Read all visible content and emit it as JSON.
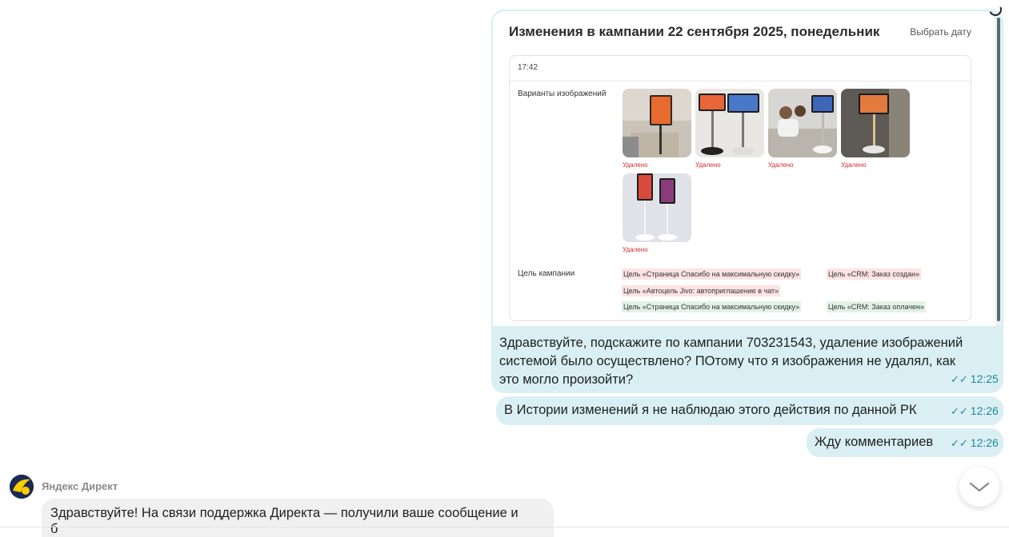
{
  "screenshot": {
    "title": "Изменения в кампании 22 сентября 2025, понедельник",
    "choose_date": "Выбрать дату",
    "time": "17:42",
    "images_label": "Варианты изображений",
    "image_status": "Удалено",
    "goal_label": "Цель кампании",
    "goals_removed": [
      "Цель «Страница Спасибо на максимальную скидку»",
      "Цель «CRM: Заказ создан»",
      "Цель «Автоцель Jivo: автоприглашение в чат»"
    ],
    "goals_added": [
      "Цель «Страница Спасибо на максимальную скидку»",
      "Цель «CRM: Заказ оплачен»"
    ]
  },
  "messages": [
    {
      "lines": [
        "Здравствуйте, подскажите по кампании 703231543, удаление изображений",
        "системой было осуществлено? ПОтому что я изображения не удалял, как",
        "это могло произойти?"
      ],
      "time": "12:25"
    },
    {
      "text": "В Истории изменений я не наблюдаю этого действия по данной РК",
      "time": "12:26"
    },
    {
      "text": "Жду комментариев",
      "time": "12:26"
    }
  ],
  "incoming": {
    "sender": "Яндекс Директ",
    "text": "Здравствуйте! На связи поддержка Директа — получили ваше сообщение и",
    "text_line2": "б"
  },
  "icons": {
    "read_ticks": "double-check-icon",
    "scroll_down": "chevron-down-icon",
    "avatar": "yandex-direct-logo"
  },
  "colors": {
    "outgoing_bubble": "#d9eff3",
    "incoming_bubble": "#f0f0f0",
    "time_accent": "#1e8a9e",
    "removed_status": "#d42b2b"
  }
}
